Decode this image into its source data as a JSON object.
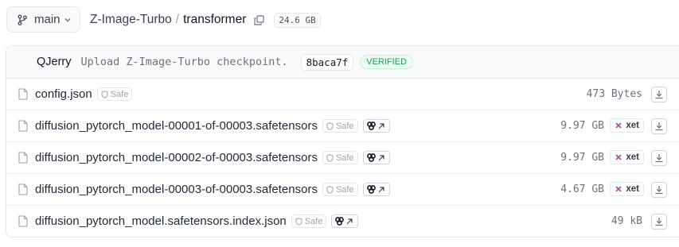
{
  "branch": {
    "label": "main",
    "icon": "git-branch-icon"
  },
  "breadcrumb": {
    "repo": "Z-Image-Turbo",
    "separator": "/",
    "folder": "transformer",
    "size": "24.6 GB"
  },
  "commit": {
    "author": "QJerry",
    "message": "Upload Z-Image-Turbo checkpoint.",
    "hash": "8baca7f",
    "status": "VERIFIED"
  },
  "files": [
    {
      "name": "config.json",
      "safe_label": "Safe",
      "size": "473 Bytes",
      "viewer": false,
      "xet": ""
    },
    {
      "name": "diffusion_pytorch_model-00001-of-00003.safetensors",
      "safe_label": "Safe",
      "size": "9.97 GB",
      "viewer": true,
      "xet": "xet"
    },
    {
      "name": "diffusion_pytorch_model-00002-of-00003.safetensors",
      "safe_label": "Safe",
      "size": "9.97 GB",
      "viewer": true,
      "xet": "xet"
    },
    {
      "name": "diffusion_pytorch_model-00003-of-00003.safetensors",
      "safe_label": "Safe",
      "size": "4.67 GB",
      "viewer": true,
      "xet": "xet"
    },
    {
      "name": "diffusion_pytorch_model.safetensors.index.json",
      "safe_label": "Safe",
      "size": "49 kB",
      "viewer": true,
      "xet": ""
    }
  ],
  "colors": {
    "verified": "#16a34a",
    "xet_accent": "#ef4444",
    "border": "#e5e7eb"
  }
}
